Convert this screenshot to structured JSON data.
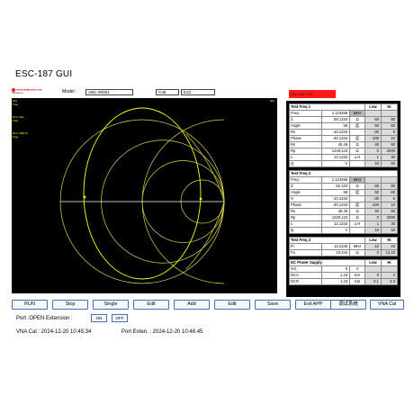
{
  "app": {
    "title": "ESC-187 GUI"
  },
  "logo": {
    "url": "www.whkasent.com",
    "name": "Whkasent"
  },
  "header": {
    "model_label": "Model :",
    "model_value": "ABC-00001",
    "field_c36": "C36",
    "field_e22": "E22",
    "badge": "ESC-187 GUI"
  },
  "chart": {
    "tag": "S11",
    "legend": [
      "S11",
      "Freq",
      "",
      "S11 / Ref",
      "Freq",
      "",
      "S11 / REF B",
      "Freq"
    ],
    "colors": {
      "background": "#000000",
      "grid": "#ffff66",
      "trace": "#ffff00",
      "axis": "#ffffff"
    }
  },
  "test1": {
    "title": "Test Freq 1",
    "low": "Low",
    "hi": "Hi",
    "rows": [
      {
        "name": "Freq.",
        "value": "1.123456",
        "unit": "MHz",
        "low": "",
        "hi": ""
      },
      {
        "name": "Z",
        "value": "58.1234",
        "unit": "Ω",
        "low": "60",
        "hi": "80"
      },
      {
        "name": "Angle",
        "value": "58",
        "unit": "度",
        "low": "50",
        "hi": "60"
      },
      {
        "name": "Rs",
        "value": "-10.1234",
        "unit": "",
        "low": "-30",
        "hi": "5"
      },
      {
        "name": "Phase",
        "value": "-30.1234",
        "unit": "度",
        "low": "-100",
        "hi": "10"
      },
      {
        "name": "Rs",
        "value": "45.46",
        "unit": "Ω",
        "low": "40",
        "hi": "60"
      },
      {
        "name": "Rp",
        "value": "1229.123",
        "unit": "Ω",
        "low": "0",
        "hi": "2000"
      },
      {
        "name": "L",
        "value": "12.1234",
        "unit": "u H",
        "low": "1",
        "hi": "30"
      },
      {
        "name": "Q",
        "value": "V",
        "unit": "",
        "low": "10",
        "hi": "50"
      }
    ]
  },
  "test2": {
    "title": "Test Freq 2",
    "rows": [
      {
        "name": "Freq.",
        "value": "1.123456",
        "unit": "MHz",
        "low": "",
        "hi": ""
      },
      {
        "name": "Z",
        "value": "62.123",
        "unit": "Ω",
        "low": "60",
        "hi": "80"
      },
      {
        "name": "Angle",
        "value": "58",
        "unit": "度",
        "low": "50",
        "hi": "60"
      },
      {
        "name": "X",
        "value": "-10.1234",
        "unit": "",
        "low": "-30",
        "hi": "5"
      },
      {
        "name": "Phase",
        "value": "-30.1234",
        "unit": "度",
        "low": "-100",
        "hi": "10"
      },
      {
        "name": "Rs",
        "value": "45.45",
        "unit": "Ω",
        "low": "40",
        "hi": "60"
      },
      {
        "name": "Rp",
        "value": "1229.123",
        "unit": "Ω",
        "low": "0",
        "hi": "2000"
      },
      {
        "name": "L",
        "value": "12.1234",
        "unit": "u H",
        "low": "1",
        "hi": "30"
      },
      {
        "name": "Q",
        "value": "V",
        "unit": "",
        "low": "10",
        "hi": "50"
      }
    ]
  },
  "test3": {
    "title": "Test Freq 3",
    "low": "Low",
    "hi": "Hi",
    "rows": [
      {
        "name": "Fr",
        "value": "13.2345",
        "unit": "MHz",
        "low": "12",
        "hi": "15"
      },
      {
        "name": "Fa",
        "value": "10.234",
        "unit": "Ω",
        "low": "0",
        "hi": "12.23"
      }
    ]
  },
  "dc": {
    "title": "DC Power Supply",
    "low": "Low",
    "hi": "Hi",
    "rows": [
      {
        "name": "Vol.",
        "value": "5",
        "unit": "V",
        "low": "",
        "hi": ""
      },
      {
        "name": "DCA",
        "value": "1.23",
        "unit": "mA",
        "low": "0",
        "hi": "2"
      },
      {
        "name": "DCR",
        "value": "1.23",
        "unit": "KΩ",
        "low": "0.1",
        "hi": "2.3"
      }
    ]
  },
  "buttons": {
    "run": "RUN",
    "stop": "Stop",
    "single": "Single",
    "edit1": "Edit",
    "add": "Add",
    "edit2": "Edit",
    "save": "Save",
    "exit_app": "Exit APP",
    "cn_button": "调试系统",
    "vna_cal": "VNA Cal"
  },
  "port": {
    "label": "Port :OPEN  Extension :",
    "on": "ON",
    "off": "OFF"
  },
  "cal": {
    "vna_label": "VNA Cal :  2024-12-20 10:45:34",
    "port_label": "Port Exten. :  2024-12-20 10:46:45"
  }
}
